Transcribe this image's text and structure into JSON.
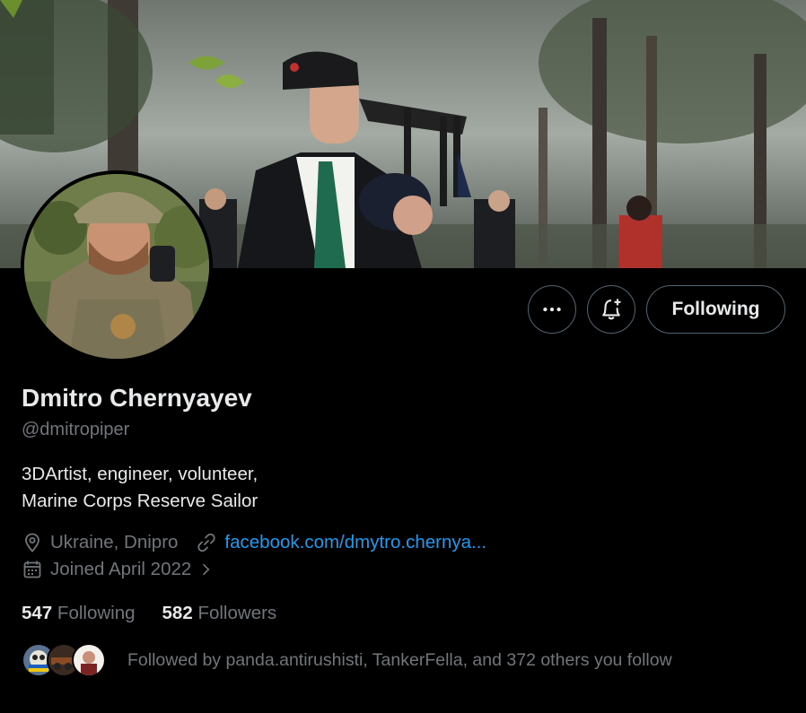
{
  "profile": {
    "name": "Dmitro Chernyayev",
    "handle": "@dmitropiper",
    "bio_line1": "3DArtist, engineer, volunteer,",
    "bio_line2": "Marine Corps Reserve Sailor",
    "location": "Ukraine, Dnipro",
    "website": "facebook.com/dmytro.chernya...",
    "joined": "Joined April 2022"
  },
  "actions": {
    "following_label": "Following"
  },
  "stats": {
    "following_count": "547",
    "following_label": "Following",
    "followers_count": "582",
    "followers_label": "Followers"
  },
  "followed_by": "Followed by panda.antirushisti, TankerFella, and 372 others you follow",
  "icons": {
    "more": "more-icon",
    "notify": "bell-plus-icon",
    "location": "location-pin-icon",
    "link": "link-icon",
    "calendar": "calendar-icon",
    "chevron": "chevron-right-icon"
  },
  "colors": {
    "background": "#000000",
    "text": "#e7e9ea",
    "muted": "#71767b",
    "link": "#1d9bf0",
    "border": "#536471"
  }
}
